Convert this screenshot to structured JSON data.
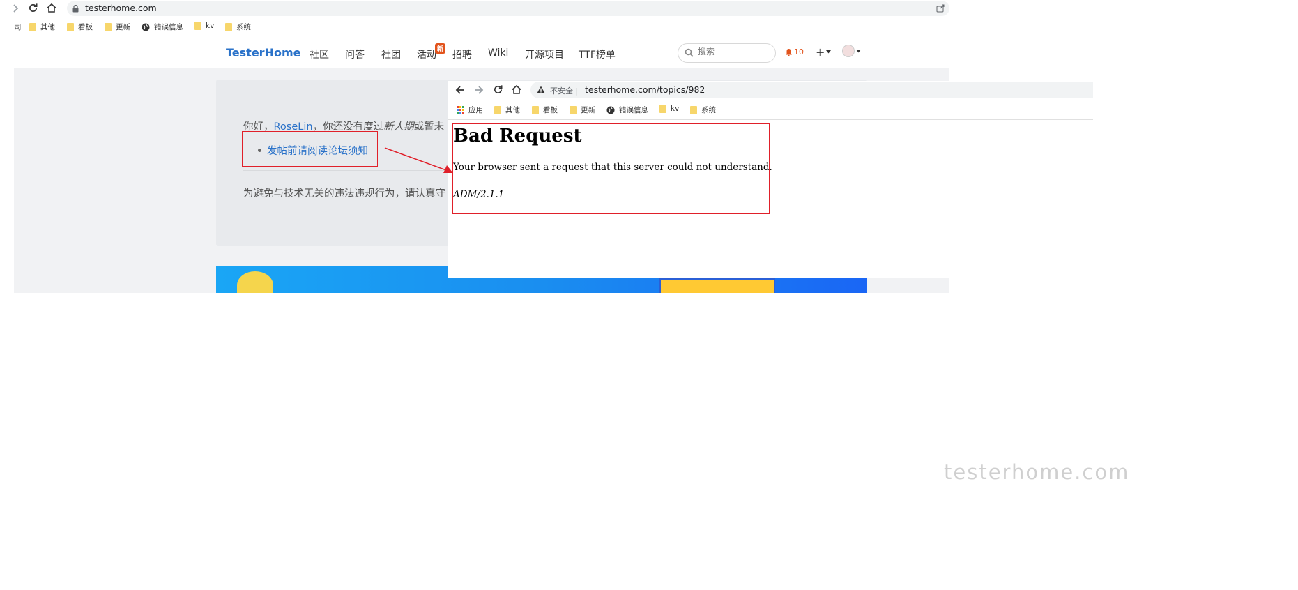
{
  "outer_browser": {
    "url": "testerhome.com",
    "bookmarks": [
      {
        "label": "其他",
        "icon": "folder-icon"
      },
      {
        "label": "看板",
        "icon": "folder-icon"
      },
      {
        "label": "更新",
        "icon": "folder-icon"
      },
      {
        "label": "错误信息",
        "icon": "globe-icon"
      },
      {
        "label": "kv",
        "icon": "folder-icon"
      },
      {
        "label": "系统",
        "icon": "folder-icon"
      }
    ]
  },
  "navbar": {
    "brand": "TesterHome",
    "items": [
      "社区",
      "问答",
      "社团",
      "活动",
      "招聘",
      "Wiki",
      "开源项目",
      "TTF榜单"
    ],
    "new_badge": "新",
    "search_placeholder": "搜索",
    "notification_count": "10"
  },
  "notice": {
    "greeting_prefix": "你好，",
    "username": "RoseLin",
    "greeting_mid": "，你还没有度过",
    "greeting_em": "新人期",
    "greeting_suffix": "或暂未",
    "rule_link": "发帖前请阅读论坛须知",
    "notice2": "为避免与技术无关的违法违规行为，请认真守"
  },
  "inner_browser": {
    "insecure_label": "不安全",
    "url": "testerhome.com/topics/982",
    "bookmarks": [
      {
        "label": "应用",
        "icon": "apps-grid-icon"
      },
      {
        "label": "其他",
        "icon": "folder-icon"
      },
      {
        "label": "看板",
        "icon": "folder-icon"
      },
      {
        "label": "更新",
        "icon": "folder-icon"
      },
      {
        "label": "错误信息",
        "icon": "globe-icon"
      },
      {
        "label": "kv",
        "icon": "folder-icon"
      },
      {
        "label": "系统",
        "icon": "folder-icon"
      }
    ]
  },
  "bad_request": {
    "title": "Bad Request",
    "message": "Your browser sent a request that this server could not understand.",
    "server": "ADM/2.1.1"
  },
  "watermark": "testerhome.com",
  "colors": {
    "brand_blue": "#2a72c9",
    "annotation_red": "#e0202a",
    "badge_orange": "#e2531c"
  }
}
